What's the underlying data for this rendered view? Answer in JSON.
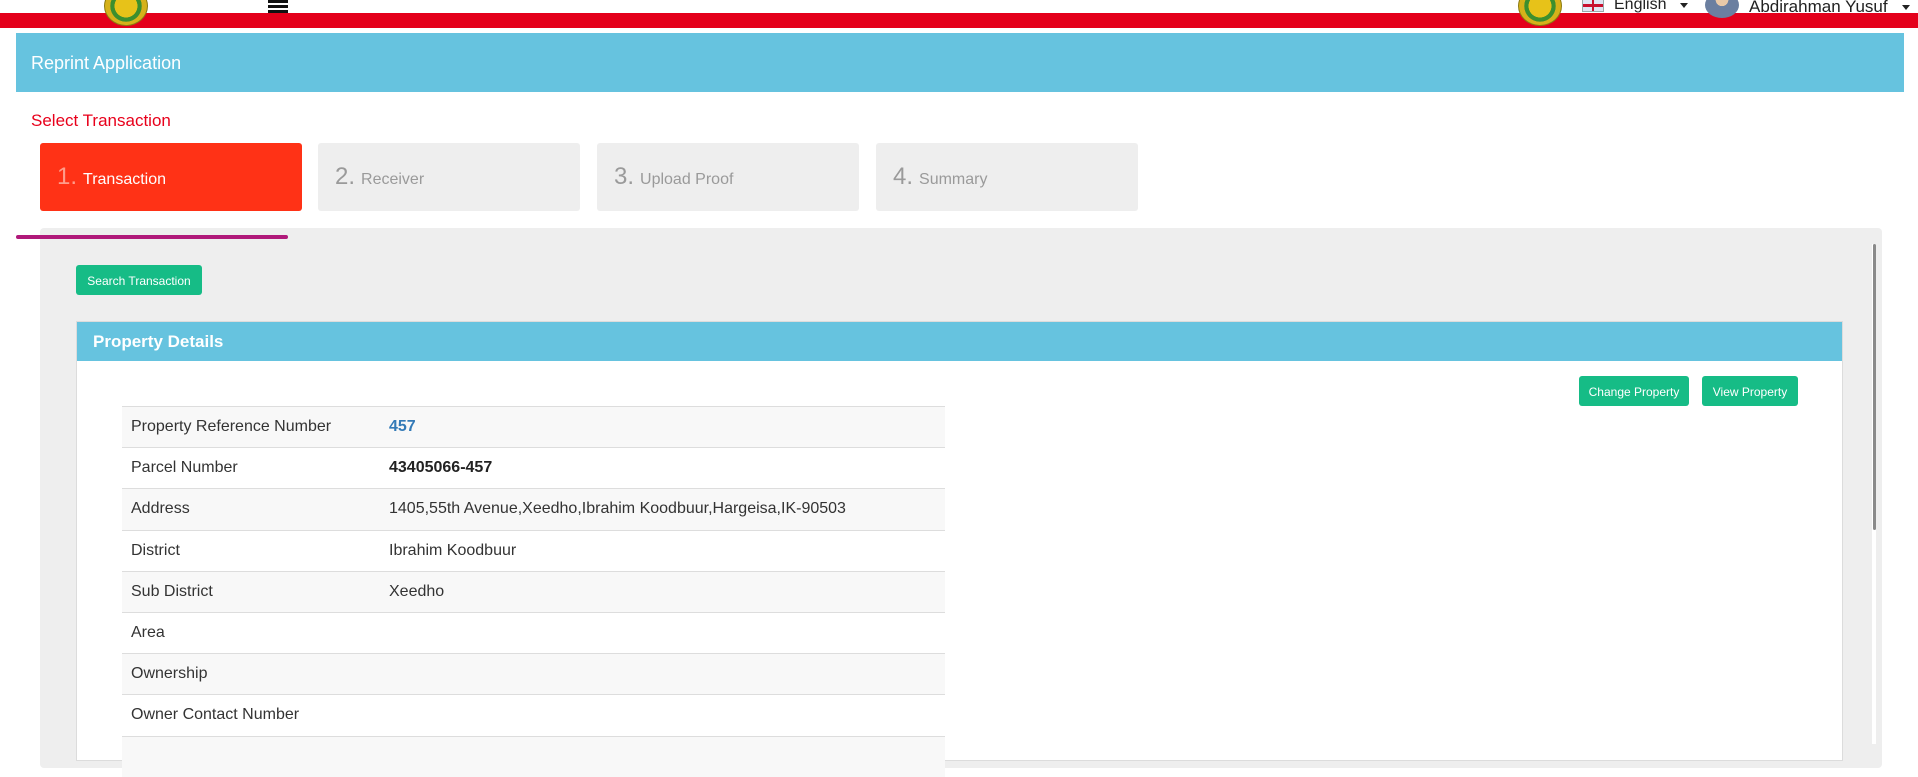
{
  "header": {
    "language": "English",
    "user_name": "Abdirahman Yusuf"
  },
  "panel": {
    "title": "Reprint Application"
  },
  "section_label": "Select Transaction",
  "steps": [
    {
      "num": "1.",
      "label": "Transaction",
      "active": true
    },
    {
      "num": "2.",
      "label": "Receiver",
      "active": false
    },
    {
      "num": "3.",
      "label": "Upload Proof",
      "active": false
    },
    {
      "num": "4.",
      "label": "Summary",
      "active": false
    }
  ],
  "buttons": {
    "search_transaction": "Search Transaction",
    "change_property": "Change Property",
    "view_property": "View Property"
  },
  "property": {
    "title": "Property Details",
    "rows": [
      {
        "label": "Property Reference Number",
        "value": "457"
      },
      {
        "label": "Parcel Number",
        "value": "43405066-457"
      },
      {
        "label": "Address",
        "value": "1405,55th Avenue,Xeedho,Ibrahim Koodbuur,Hargeisa,IK-90503"
      },
      {
        "label": "District",
        "value": "Ibrahim Koodbuur"
      },
      {
        "label": "Sub District",
        "value": "Xeedho"
      },
      {
        "label": "Area",
        "value": ""
      },
      {
        "label": "Ownership",
        "value": ""
      },
      {
        "label": "Owner Contact Number",
        "value": ""
      }
    ]
  },
  "colors": {
    "header_bar": "#e4001b",
    "panel": "#66c3df",
    "active_step": "#ff3216",
    "primary_button": "#16bc86",
    "link": "#337ab7"
  }
}
